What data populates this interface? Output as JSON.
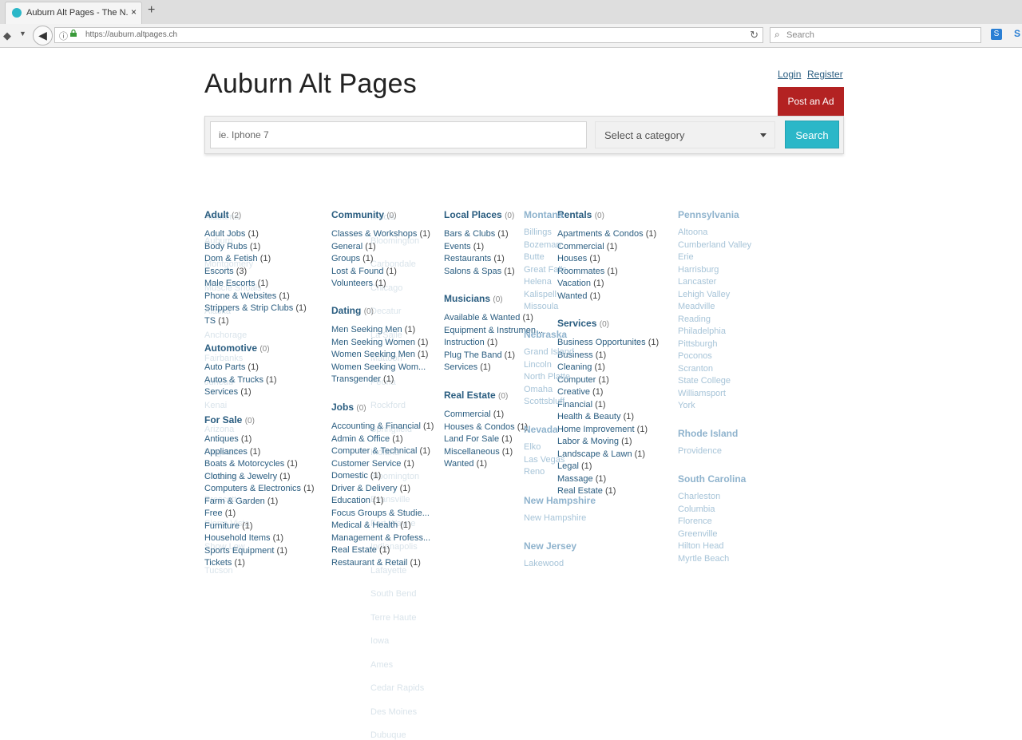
{
  "browser": {
    "tab_title": "Auburn Alt Pages - The N...",
    "tab_close": "×",
    "new_tab": "+",
    "url": "https://auburn.altpages.ch",
    "search_placeholder": "Search",
    "ext_label": "S"
  },
  "header": {
    "title": "Auburn Alt Pages",
    "login": "Login",
    "register": "Register",
    "post_ad": "Post an Ad"
  },
  "search": {
    "placeholder": "ie. Iphone 7",
    "category_placeholder": "Select a category",
    "button": "Search"
  },
  "categories": [
    {
      "name": "Adult",
      "count": "(2)",
      "items": [
        {
          "label": "Adult Jobs",
          "count": "(1)"
        },
        {
          "label": "Body Rubs",
          "count": "(1)"
        },
        {
          "label": "Dom & Fetish",
          "count": "(1)"
        },
        {
          "label": "Escorts",
          "count": "(3)"
        },
        {
          "label": "Male Escorts",
          "count": "(1)"
        },
        {
          "label": "Phone & Websites",
          "count": "(1)"
        },
        {
          "label": "Strippers & Strip Clubs",
          "count": "(1)"
        },
        {
          "label": "TS",
          "count": "(1)"
        }
      ]
    },
    {
      "name": "Automotive",
      "count": "(0)",
      "items": [
        {
          "label": "Auto Parts",
          "count": "(1)"
        },
        {
          "label": "Autos & Trucks",
          "count": "(1)"
        },
        {
          "label": "Services",
          "count": "(1)"
        }
      ]
    },
    {
      "name": "For Sale",
      "count": "(0)",
      "items": [
        {
          "label": "Antiques",
          "count": "(1)"
        },
        {
          "label": "Appliances",
          "count": "(1)"
        },
        {
          "label": "Boats & Motorcycles",
          "count": "(1)"
        },
        {
          "label": "Clothing & Jewelry",
          "count": "(1)"
        },
        {
          "label": "Computers & Electronics",
          "count": "(1)"
        },
        {
          "label": "Farm & Garden",
          "count": "(1)"
        },
        {
          "label": "Free",
          "count": "(1)"
        },
        {
          "label": "Furniture",
          "count": "(1)"
        },
        {
          "label": "Household Items",
          "count": "(1)"
        },
        {
          "label": "Sports Equipment",
          "count": "(1)"
        },
        {
          "label": "Tickets",
          "count": "(1)"
        }
      ]
    },
    {
      "name": "Community",
      "count": "(0)",
      "items": [
        {
          "label": "Classes & Workshops",
          "count": "(1)"
        },
        {
          "label": "General",
          "count": "(1)"
        },
        {
          "label": "Groups",
          "count": "(1)"
        },
        {
          "label": "Lost & Found",
          "count": "(1)"
        },
        {
          "label": "Volunteers",
          "count": "(1)"
        }
      ]
    },
    {
      "name": "Dating",
      "count": "(0)",
      "items": [
        {
          "label": "Men Seeking Men",
          "count": "(1)"
        },
        {
          "label": "Men Seeking Women",
          "count": "(1)"
        },
        {
          "label": "Women Seeking Men",
          "count": "(1)"
        },
        {
          "label": "Women Seeking Wom...",
          "count": ""
        },
        {
          "label": "Transgender",
          "count": "(1)"
        }
      ]
    },
    {
      "name": "Jobs",
      "count": "(0)",
      "items": [
        {
          "label": "Accounting & Financial",
          "count": "(1)"
        },
        {
          "label": "Admin & Office",
          "count": "(1)"
        },
        {
          "label": "Computer & Technical",
          "count": "(1)"
        },
        {
          "label": "Customer Service",
          "count": "(1)"
        },
        {
          "label": "Domestic",
          "count": "(1)"
        },
        {
          "label": "Driver & Delivery",
          "count": "(1)"
        },
        {
          "label": "Education",
          "count": "(1)"
        },
        {
          "label": "Focus Groups & Studie...",
          "count": ""
        },
        {
          "label": "Medical & Health",
          "count": "(1)"
        },
        {
          "label": "Management & Profess...",
          "count": ""
        },
        {
          "label": "Real Estate",
          "count": "(1)"
        },
        {
          "label": "Restaurant & Retail",
          "count": "(1)"
        }
      ]
    },
    {
      "name": "Local Places",
      "count": "(0)",
      "items": [
        {
          "label": "Bars & Clubs",
          "count": "(1)"
        },
        {
          "label": "Events",
          "count": "(1)"
        },
        {
          "label": "Restaurants",
          "count": "(1)"
        },
        {
          "label": "Salons & Spas",
          "count": "(1)"
        }
      ]
    },
    {
      "name": "Musicians",
      "count": "(0)",
      "items": [
        {
          "label": "Available & Wanted",
          "count": "(1)"
        },
        {
          "label": "Equipment & Instrumen...",
          "count": ""
        },
        {
          "label": "Instruction",
          "count": "(1)"
        },
        {
          "label": "Plug The Band",
          "count": "(1)"
        },
        {
          "label": "Services",
          "count": "(1)"
        }
      ]
    },
    {
      "name": "Real Estate",
      "count": "(0)",
      "items": [
        {
          "label": "Commercial",
          "count": "(1)"
        },
        {
          "label": "Houses & Condos",
          "count": "(1)"
        },
        {
          "label": "Land For Sale",
          "count": "(1)"
        },
        {
          "label": "Miscellaneous",
          "count": "(1)"
        },
        {
          "label": "Wanted",
          "count": "(1)"
        }
      ]
    },
    {
      "name": "Rentals",
      "count": "(0)",
      "items": [
        {
          "label": "Apartments & Condos",
          "count": "(1)"
        },
        {
          "label": "Commercial",
          "count": "(1)"
        },
        {
          "label": "Houses",
          "count": "(1)"
        },
        {
          "label": "Roommates",
          "count": "(1)"
        },
        {
          "label": "Vacation",
          "count": "(1)"
        },
        {
          "label": "Wanted",
          "count": "(1)"
        }
      ]
    },
    {
      "name": "Services",
      "count": "(0)",
      "items": [
        {
          "label": "Business Opportunites",
          "count": "(1)"
        },
        {
          "label": "Business",
          "count": "(1)"
        },
        {
          "label": "Cleaning",
          "count": "(1)"
        },
        {
          "label": "Computer",
          "count": "(1)"
        },
        {
          "label": "Creative",
          "count": "(1)"
        },
        {
          "label": "Financial",
          "count": "(1)"
        },
        {
          "label": "Health & Beauty",
          "count": "(1)"
        },
        {
          "label": "Home Improvement",
          "count": "(1)"
        },
        {
          "label": "Labor & Moving",
          "count": "(1)"
        },
        {
          "label": "Landscape & Lawn",
          "count": "(1)"
        },
        {
          "label": "Legal",
          "count": "(1)"
        },
        {
          "label": "Massage",
          "count": "(1)"
        },
        {
          "label": "Real Estate",
          "count": "(1)"
        }
      ]
    }
  ],
  "states": [
    {
      "name": "Montana",
      "cities": [
        "Billings",
        "Bozeman",
        "Butte",
        "Great Falls",
        "Helena",
        "Kalispell",
        "Missoula"
      ]
    },
    {
      "name": "Nebraska",
      "cities": [
        "Grand Island",
        "Lincoln",
        "North Platte",
        "Omaha",
        "Scottsbluff"
      ]
    },
    {
      "name": "Nevada",
      "cities": [
        "Elko",
        "Las Vegas",
        "Reno"
      ]
    },
    {
      "name": "New Hampshire",
      "cities": [
        "New Hampshire"
      ]
    },
    {
      "name": "New Jersey",
      "cities": [
        "Lakewood"
      ]
    },
    {
      "name": "Pennsylvania",
      "cities": [
        "Altoona",
        "Cumberland Valley",
        "Erie",
        "Harrisburg",
        "Lancaster",
        "Lehigh Valley",
        "Meadville",
        "Reading",
        "Philadelphia",
        "Pittsburgh",
        "Poconos",
        "Scranton",
        "State College",
        "Williamsport",
        "York"
      ]
    },
    {
      "name": "Rhode Island",
      "cities": [
        "Providence"
      ]
    },
    {
      "name": "South Carolina",
      "cities": [
        "Charleston",
        "Columbia",
        "Florence",
        "Greenville",
        "Hilton Head",
        "Myrtle Beach"
      ]
    }
  ],
  "ghost_text": {
    "col1": [
      "Alabama",
      "Auburn",
      "Montgomery",
      "Muscle Shoals",
      "Alaska",
      "Anchorage",
      "Fairbanks",
      "Juneau",
      "Kenai",
      "Arizona",
      "Flagstaff",
      "Phoenix",
      "Prescott",
      "Sierra Vista",
      "Show Low",
      "Tucson"
    ],
    "col2": [
      "Illinois",
      "Bloomington",
      "Carbondale",
      "Chicago",
      "Decatur",
      "La Salle",
      "Mattoon",
      "Peoria",
      "Rockford",
      "Springfield",
      "Indiana",
      "Bloomington",
      "Evansville",
      "Fort Wayne",
      "Indianapolis",
      "Lafayette",
      "South Bend",
      "Terre Haute",
      "Iowa",
      "Ames",
      "Cedar Rapids",
      "Des Moines",
      "Dubuque"
    ]
  }
}
